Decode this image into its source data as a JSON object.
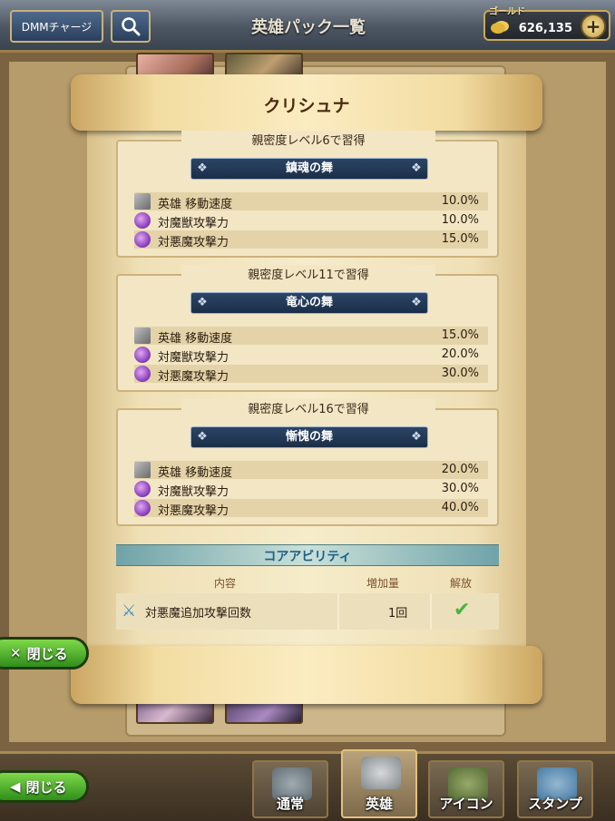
{
  "header": {
    "dmm_charge_label": "DMMチャージ",
    "title": "英雄パック一覧",
    "gold_label": "ゴールド",
    "gold_value": "626,135",
    "add_gold_label": "+"
  },
  "panel": {
    "hero_name": "クリシュナ",
    "skills": [
      {
        "unlock": "親密度レベル6で習得",
        "name": "鎮魂の舞",
        "effects": [
          {
            "icon": "axe-icon",
            "label": "英雄 移動速度",
            "value": "10.0%"
          },
          {
            "icon": "demon-orb-icon",
            "label": "対魔獣攻撃力",
            "value": "10.0%"
          },
          {
            "icon": "demon-orb-icon",
            "label": "対悪魔攻撃力",
            "value": "15.0%"
          }
        ]
      },
      {
        "unlock": "親密度レベル11で習得",
        "name": "竜心の舞",
        "effects": [
          {
            "icon": "axe-icon",
            "label": "英雄 移動速度",
            "value": "15.0%"
          },
          {
            "icon": "demon-orb-icon",
            "label": "対魔獣攻撃力",
            "value": "20.0%"
          },
          {
            "icon": "demon-orb-icon",
            "label": "対悪魔攻撃力",
            "value": "30.0%"
          }
        ]
      },
      {
        "unlock": "親密度レベル16で習得",
        "name": "慚愧の舞",
        "effects": [
          {
            "icon": "axe-icon",
            "label": "英雄 移動速度",
            "value": "20.0%"
          },
          {
            "icon": "demon-orb-icon",
            "label": "対魔獣攻撃力",
            "value": "30.0%"
          },
          {
            "icon": "demon-orb-icon",
            "label": "対悪魔攻撃力",
            "value": "40.0%"
          }
        ]
      }
    ],
    "core": {
      "title": "コアアビリティ",
      "col_content": "内容",
      "col_amount": "増加量",
      "col_unlock": "解放",
      "row": {
        "icon": "twin-blade-icon",
        "label": "対悪魔追加攻撃回数",
        "amount": "1回",
        "unlocked": "✔"
      }
    },
    "close_label": "閉じる"
  },
  "footer": {
    "close_label": "閉じる",
    "tabs": [
      {
        "label": "通常",
        "active": false
      },
      {
        "label": "英雄",
        "active": true
      },
      {
        "label": "アイコン",
        "active": false
      },
      {
        "label": "スタンプ",
        "active": false
      }
    ]
  },
  "colors": {
    "banner_navy": "#1b2e48",
    "core_title_blue": "#1f5f88",
    "close_green": "#2f8f1a",
    "check_green": "#4bb33b"
  }
}
